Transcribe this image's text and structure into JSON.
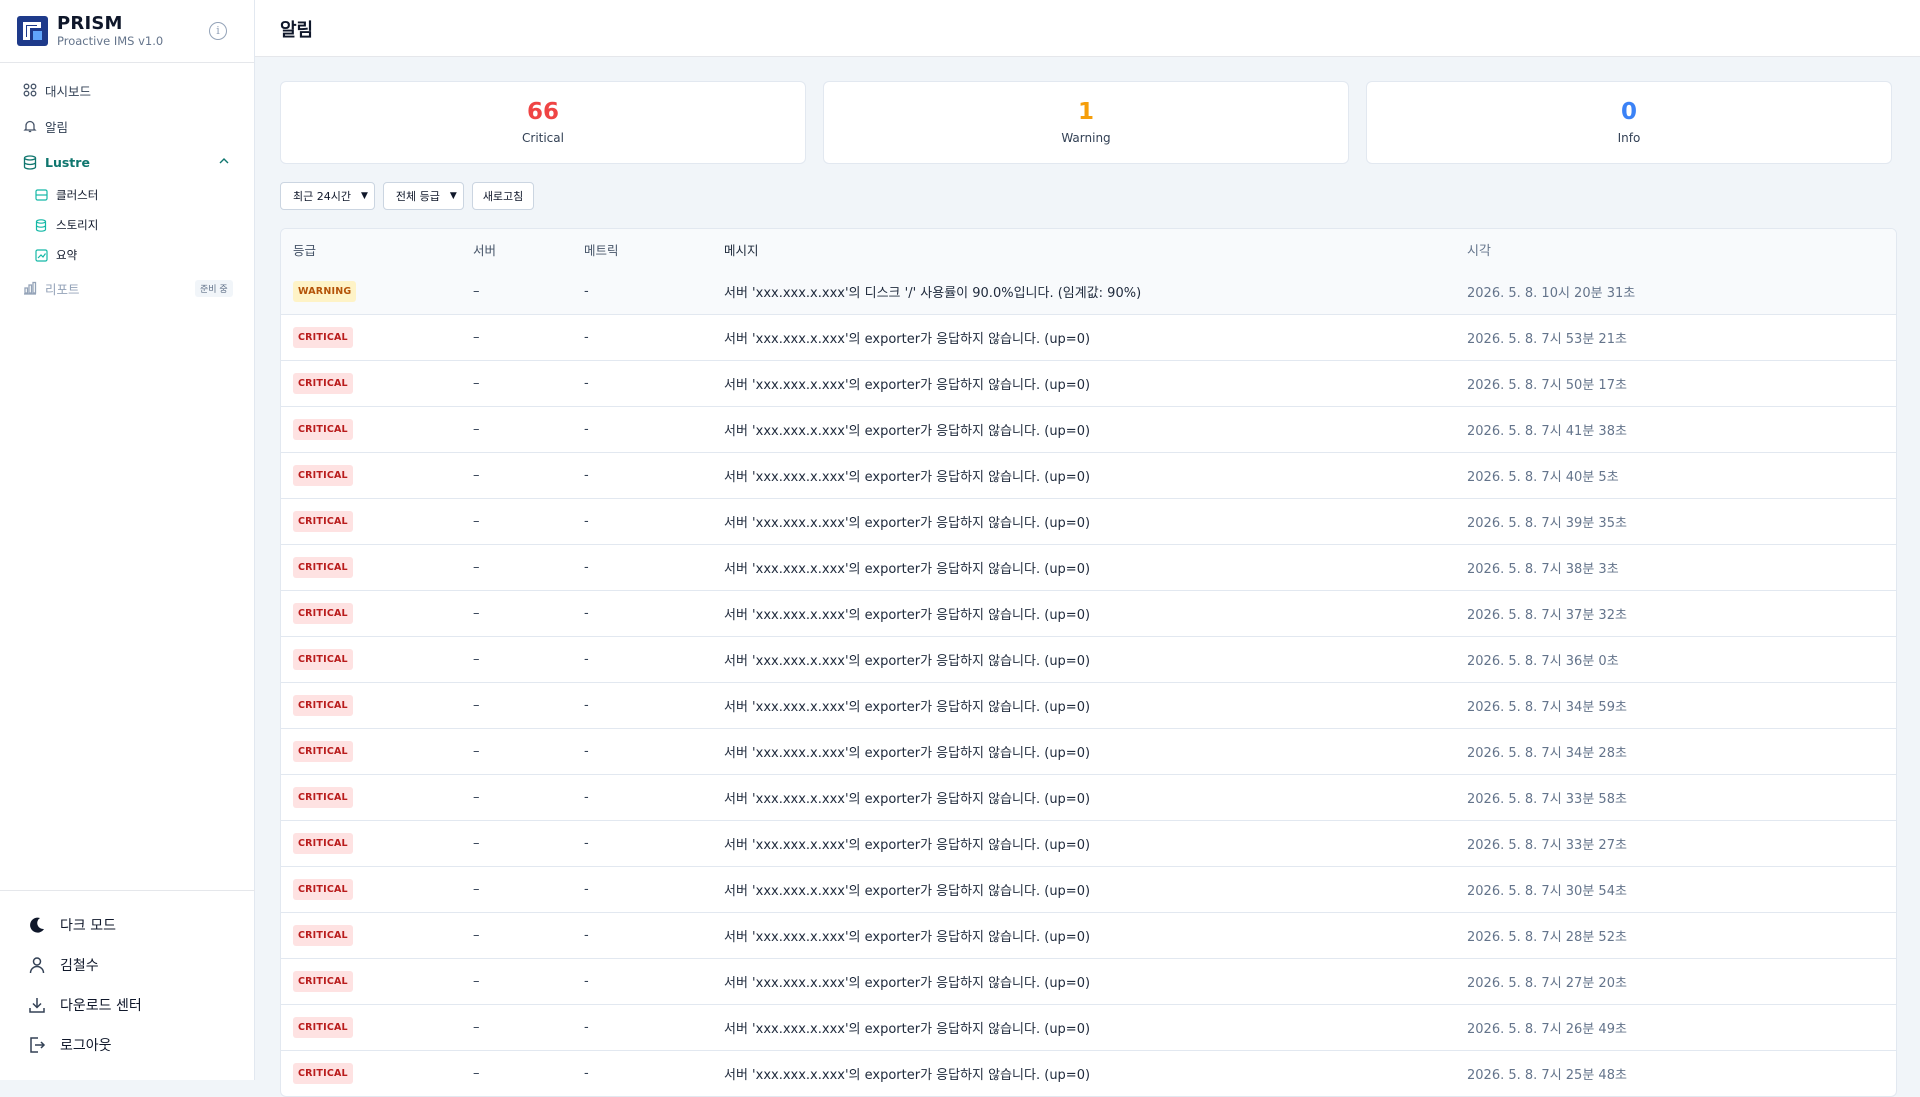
{
  "brand": {
    "name": "PRISM",
    "subtitle": "Proactive IMS v1.0"
  },
  "nav": {
    "dashboard": "대시보드",
    "alerts": "알림",
    "lustre": "Lustre",
    "cluster": "클러스터",
    "storage": "스토리지",
    "summary": "요약",
    "report": "리포트",
    "report_badge": "준비 중"
  },
  "bottom": {
    "dark_mode": "다크 모드",
    "user": "김철수",
    "download": "다운로드 센터",
    "logout": "로그아웃"
  },
  "page": {
    "title": "알림"
  },
  "cards": [
    {
      "value": "66",
      "label": "Critical",
      "color": "#ef4444"
    },
    {
      "value": "1",
      "label": "Warning",
      "color": "#f59e0b"
    },
    {
      "value": "0",
      "label": "Info",
      "color": "#3b82f6"
    }
  ],
  "filters": {
    "period": "최근 24시간",
    "level": "전체 등급",
    "refresh": "새로고침"
  },
  "table": {
    "headers": {
      "level": "등급",
      "server": "서버",
      "metric": "메트릭",
      "message": "메시지",
      "time": "시각"
    },
    "rows": [
      {
        "level": "WARNING",
        "server": "–",
        "metric": "-",
        "message": "서버 'xxx.xxx.x.xxx'의 디스크 '/' 사용률이 90.0%입니다. (임계값: 90%)",
        "time": "2026. 5. 8. 10시 20분 31초"
      },
      {
        "level": "CRITICAL",
        "server": "–",
        "metric": "-",
        "message": "서버 'xxx.xxx.x.xxx'의 exporter가 응답하지 않습니다. (up=0)",
        "time": "2026. 5. 8. 7시 53분 21초"
      },
      {
        "level": "CRITICAL",
        "server": "–",
        "metric": "-",
        "message": "서버 'xxx.xxx.x.xxx'의 exporter가 응답하지 않습니다. (up=0)",
        "time": "2026. 5. 8. 7시 50분 17초"
      },
      {
        "level": "CRITICAL",
        "server": "–",
        "metric": "-",
        "message": "서버 'xxx.xxx.x.xxx'의 exporter가 응답하지 않습니다. (up=0)",
        "time": "2026. 5. 8. 7시 41분 38초"
      },
      {
        "level": "CRITICAL",
        "server": "–",
        "metric": "-",
        "message": "서버 'xxx.xxx.x.xxx'의 exporter가 응답하지 않습니다. (up=0)",
        "time": "2026. 5. 8. 7시 40분 5초"
      },
      {
        "level": "CRITICAL",
        "server": "–",
        "metric": "-",
        "message": "서버 'xxx.xxx.x.xxx'의 exporter가 응답하지 않습니다. (up=0)",
        "time": "2026. 5. 8. 7시 39분 35초"
      },
      {
        "level": "CRITICAL",
        "server": "–",
        "metric": "-",
        "message": "서버 'xxx.xxx.x.xxx'의 exporter가 응답하지 않습니다. (up=0)",
        "time": "2026. 5. 8. 7시 38분 3초"
      },
      {
        "level": "CRITICAL",
        "server": "–",
        "metric": "-",
        "message": "서버 'xxx.xxx.x.xxx'의 exporter가 응답하지 않습니다. (up=0)",
        "time": "2026. 5. 8. 7시 37분 32초"
      },
      {
        "level": "CRITICAL",
        "server": "–",
        "metric": "-",
        "message": "서버 'xxx.xxx.x.xxx'의 exporter가 응답하지 않습니다. (up=0)",
        "time": "2026. 5. 8. 7시 36분 0초"
      },
      {
        "level": "CRITICAL",
        "server": "–",
        "metric": "-",
        "message": "서버 'xxx.xxx.x.xxx'의 exporter가 응답하지 않습니다. (up=0)",
        "time": "2026. 5. 8. 7시 34분 59초"
      },
      {
        "level": "CRITICAL",
        "server": "–",
        "metric": "-",
        "message": "서버 'xxx.xxx.x.xxx'의 exporter가 응답하지 않습니다. (up=0)",
        "time": "2026. 5. 8. 7시 34분 28초"
      },
      {
        "level": "CRITICAL",
        "server": "–",
        "metric": "-",
        "message": "서버 'xxx.xxx.x.xxx'의 exporter가 응답하지 않습니다. (up=0)",
        "time": "2026. 5. 8. 7시 33분 58초"
      },
      {
        "level": "CRITICAL",
        "server": "–",
        "metric": "-",
        "message": "서버 'xxx.xxx.x.xxx'의 exporter가 응답하지 않습니다. (up=0)",
        "time": "2026. 5. 8. 7시 33분 27초"
      },
      {
        "level": "CRITICAL",
        "server": "–",
        "metric": "-",
        "message": "서버 'xxx.xxx.x.xxx'의 exporter가 응답하지 않습니다. (up=0)",
        "time": "2026. 5. 8. 7시 30분 54초"
      },
      {
        "level": "CRITICAL",
        "server": "–",
        "metric": "-",
        "message": "서버 'xxx.xxx.x.xxx'의 exporter가 응답하지 않습니다. (up=0)",
        "time": "2026. 5. 8. 7시 28분 52초"
      },
      {
        "level": "CRITICAL",
        "server": "–",
        "metric": "-",
        "message": "서버 'xxx.xxx.x.xxx'의 exporter가 응답하지 않습니다. (up=0)",
        "time": "2026. 5. 8. 7시 27분 20초"
      },
      {
        "level": "CRITICAL",
        "server": "–",
        "metric": "-",
        "message": "서버 'xxx.xxx.x.xxx'의 exporter가 응답하지 않습니다. (up=0)",
        "time": "2026. 5. 8. 7시 26분 49초"
      },
      {
        "level": "CRITICAL",
        "server": "–",
        "metric": "-",
        "message": "서버 'xxx.xxx.x.xxx'의 exporter가 응답하지 않습니다. (up=0)",
        "time": "2026. 5. 8. 7시 25분 48초"
      }
    ]
  }
}
